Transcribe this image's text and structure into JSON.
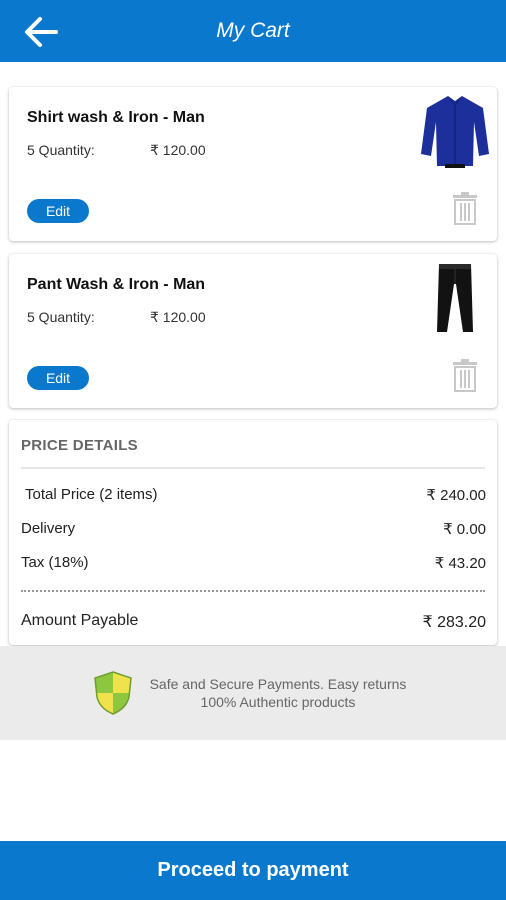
{
  "app_bar": {
    "title": "My Cart",
    "back_icon": "arrow-left-icon",
    "color": "#0a78cc"
  },
  "cart_items": [
    {
      "title": "Shirt wash & Iron - Man",
      "quantity_label": "5 Quantity:",
      "price": "₹ 120.00",
      "edit_label": "Edit",
      "image_icon": "shirt-icon",
      "delete_icon": "trash-icon"
    },
    {
      "title": "Pant Wash & Iron - Man",
      "quantity_label": "5 Quantity:",
      "price": "₹ 120.00",
      "edit_label": "Edit",
      "image_icon": "pants-icon",
      "delete_icon": "trash-icon"
    }
  ],
  "price_details": {
    "heading": "PRICE DETAILS",
    "rows": [
      {
        "label": "Total Price (2 items)",
        "value": "₹ 240.00"
      },
      {
        "label": "Delivery",
        "value": "₹ 0.00"
      },
      {
        "label": "Tax (18%)",
        "value": "₹ 43.20"
      }
    ],
    "payable_label": "Amount Payable",
    "payable_value": "₹ 283.20"
  },
  "secure_banner": {
    "icon": "shield-icon",
    "line1": "Safe and Secure Payments. Easy returns",
    "line2": "100% Authentic products"
  },
  "footer": {
    "proceed_label": "Proceed to payment"
  }
}
